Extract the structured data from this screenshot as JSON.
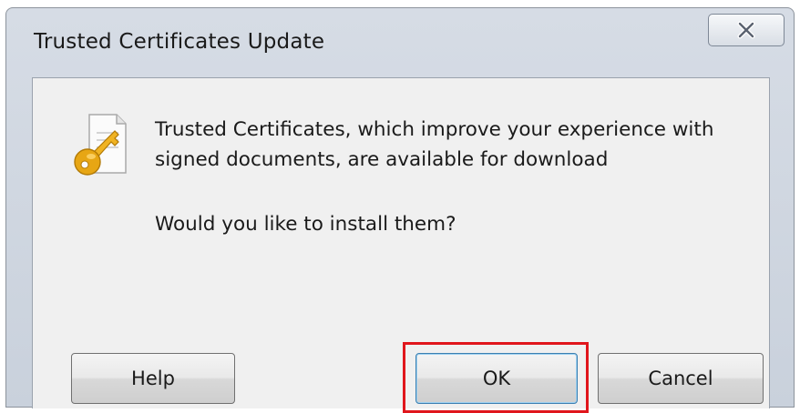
{
  "dialog": {
    "title": "Trusted Certificates Update",
    "message": "Trusted Certificates, which improve your experience with signed documents, are available for download",
    "question": "Would you like to install them?",
    "icon": "certificate-key-icon"
  },
  "buttons": {
    "help_label": "Help",
    "ok_label": "OK",
    "cancel_label": "Cancel"
  },
  "colors": {
    "highlight": "#e0161c",
    "key_gold": "#e7a614"
  }
}
